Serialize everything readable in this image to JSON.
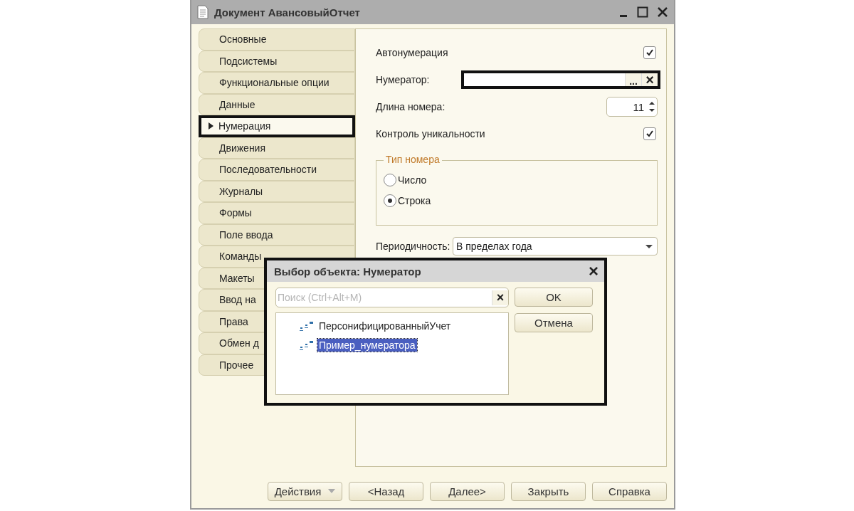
{
  "window": {
    "title": "Документ АвансовыйОтчет"
  },
  "tabs": [
    {
      "label": "Основные",
      "selected": false
    },
    {
      "label": "Подсистемы",
      "selected": false
    },
    {
      "label": "Функциональные опции",
      "selected": false
    },
    {
      "label": "Данные",
      "selected": false
    },
    {
      "label": "Нумерация",
      "selected": true
    },
    {
      "label": "Движения",
      "selected": false
    },
    {
      "label": "Последовательности",
      "selected": false
    },
    {
      "label": "Журналы",
      "selected": false
    },
    {
      "label": "Формы",
      "selected": false
    },
    {
      "label": "Поле ввода",
      "selected": false
    },
    {
      "label": "Команды",
      "selected": false
    },
    {
      "label": "Макеты",
      "selected": false
    },
    {
      "label": "Ввод на",
      "selected": false
    },
    {
      "label": "Права",
      "selected": false
    },
    {
      "label": "Обмен д",
      "selected": false
    },
    {
      "label": "Прочее",
      "selected": false
    }
  ],
  "numbering": {
    "autonumbering": {
      "label": "Автонумерация",
      "checked": true
    },
    "numerator": {
      "label": "Нумератор:",
      "select_button": "...",
      "clear_button": "×"
    },
    "length": {
      "label": "Длина номера:",
      "value": "11"
    },
    "uniqueness": {
      "label": "Контроль уникальности",
      "checked": true
    },
    "number_type": {
      "title": "Тип номера",
      "options": [
        {
          "label": "Число",
          "selected": false
        },
        {
          "label": "Строка",
          "selected": true
        }
      ]
    },
    "periodicity": {
      "label": "Периодичность:",
      "value": "В пределах года"
    }
  },
  "dialog": {
    "title": "Выбор объекта: Нумератор",
    "close": "×",
    "search": {
      "placeholder": "Поиск (Ctrl+Alt+M)",
      "clear": "×"
    },
    "items": [
      {
        "label": "ПерсонифицированныйУчет",
        "selected": false
      },
      {
        "label": "Пример_нумератора",
        "selected": true
      }
    ],
    "buttons": [
      "OK",
      "Отмена"
    ]
  },
  "footer_buttons": [
    {
      "label": "Действия",
      "kind": "menu"
    },
    {
      "label": "<Назад",
      "kind": "plain"
    },
    {
      "label": "Далее>",
      "kind": "plain"
    },
    {
      "label": "Закрыть",
      "kind": "plain"
    },
    {
      "label": "Справка",
      "kind": "plain"
    }
  ]
}
